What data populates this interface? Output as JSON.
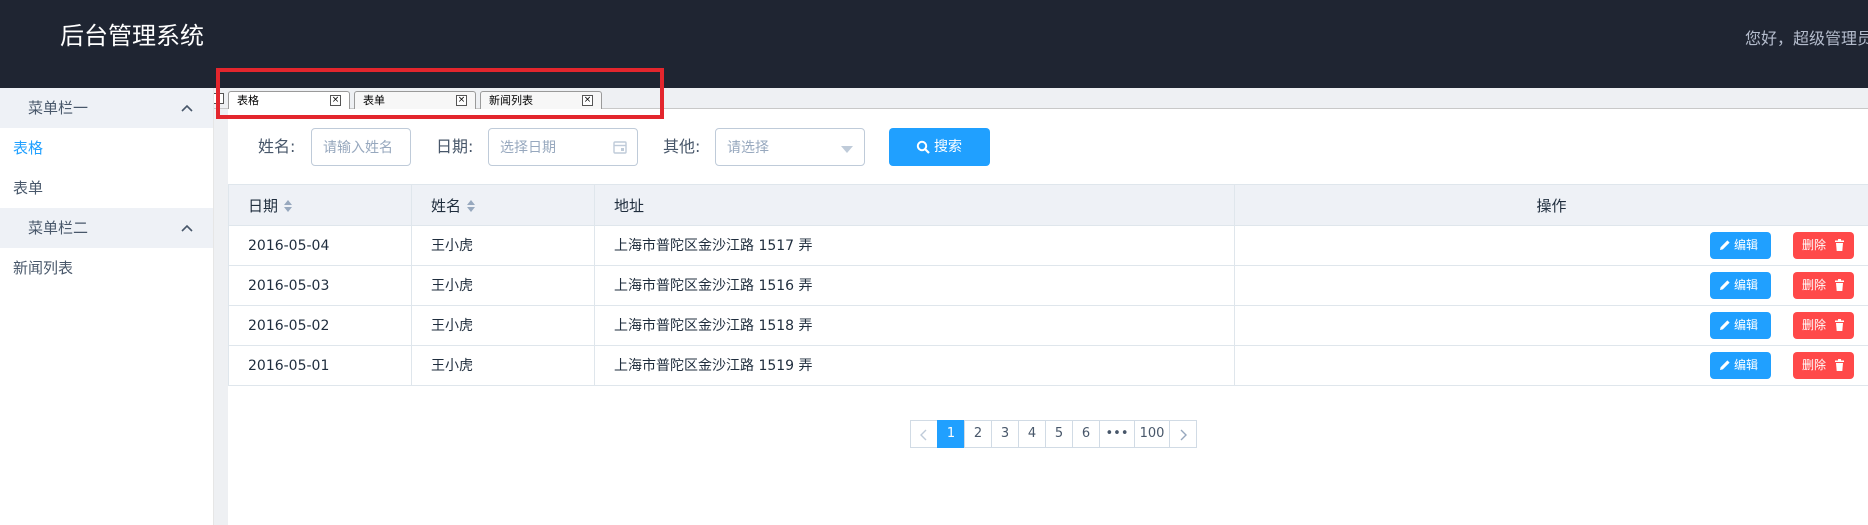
{
  "header": {
    "title": "后台管理系统",
    "greeting": "您好，超级管理员"
  },
  "sidebar": {
    "groups": [
      {
        "label": "菜单栏一",
        "items": [
          {
            "label": "表格",
            "active": true
          },
          {
            "label": "表单",
            "active": false
          }
        ]
      },
      {
        "label": "菜单栏二",
        "items": [
          {
            "label": "新闻列表",
            "active": false
          }
        ]
      }
    ]
  },
  "tabs": [
    {
      "label": "表格",
      "close": "×"
    },
    {
      "label": "表单",
      "close": "×"
    },
    {
      "label": "新闻列表",
      "close": "×"
    }
  ],
  "form": {
    "name_label": "姓名:",
    "name_placeholder": "请输入姓名",
    "date_label": "日期:",
    "date_placeholder": "选择日期",
    "other_label": "其他:",
    "other_placeholder": "请选择",
    "search_label": "搜索"
  },
  "table": {
    "headers": {
      "date": "日期",
      "name": "姓名",
      "address": "地址",
      "actions": "操作"
    },
    "rows": [
      {
        "date": "2016-05-04",
        "name": "王小虎",
        "address": "上海市普陀区金沙江路 1517 弄"
      },
      {
        "date": "2016-05-03",
        "name": "王小虎",
        "address": "上海市普陀区金沙江路 1516 弄"
      },
      {
        "date": "2016-05-02",
        "name": "王小虎",
        "address": "上海市普陀区金沙江路 1518 弄"
      },
      {
        "date": "2016-05-01",
        "name": "王小虎",
        "address": "上海市普陀区金沙江路 1519 弄"
      }
    ],
    "edit_label": "编辑",
    "delete_label": "删除"
  },
  "pagination": {
    "pages": [
      "1",
      "2",
      "3",
      "4",
      "5",
      "6",
      "•••",
      "100"
    ],
    "current": "1"
  },
  "colors": {
    "primary": "#20a0ff",
    "danger": "#ff4949",
    "header_bg": "#1f2532",
    "highlight": "#e3262d"
  }
}
